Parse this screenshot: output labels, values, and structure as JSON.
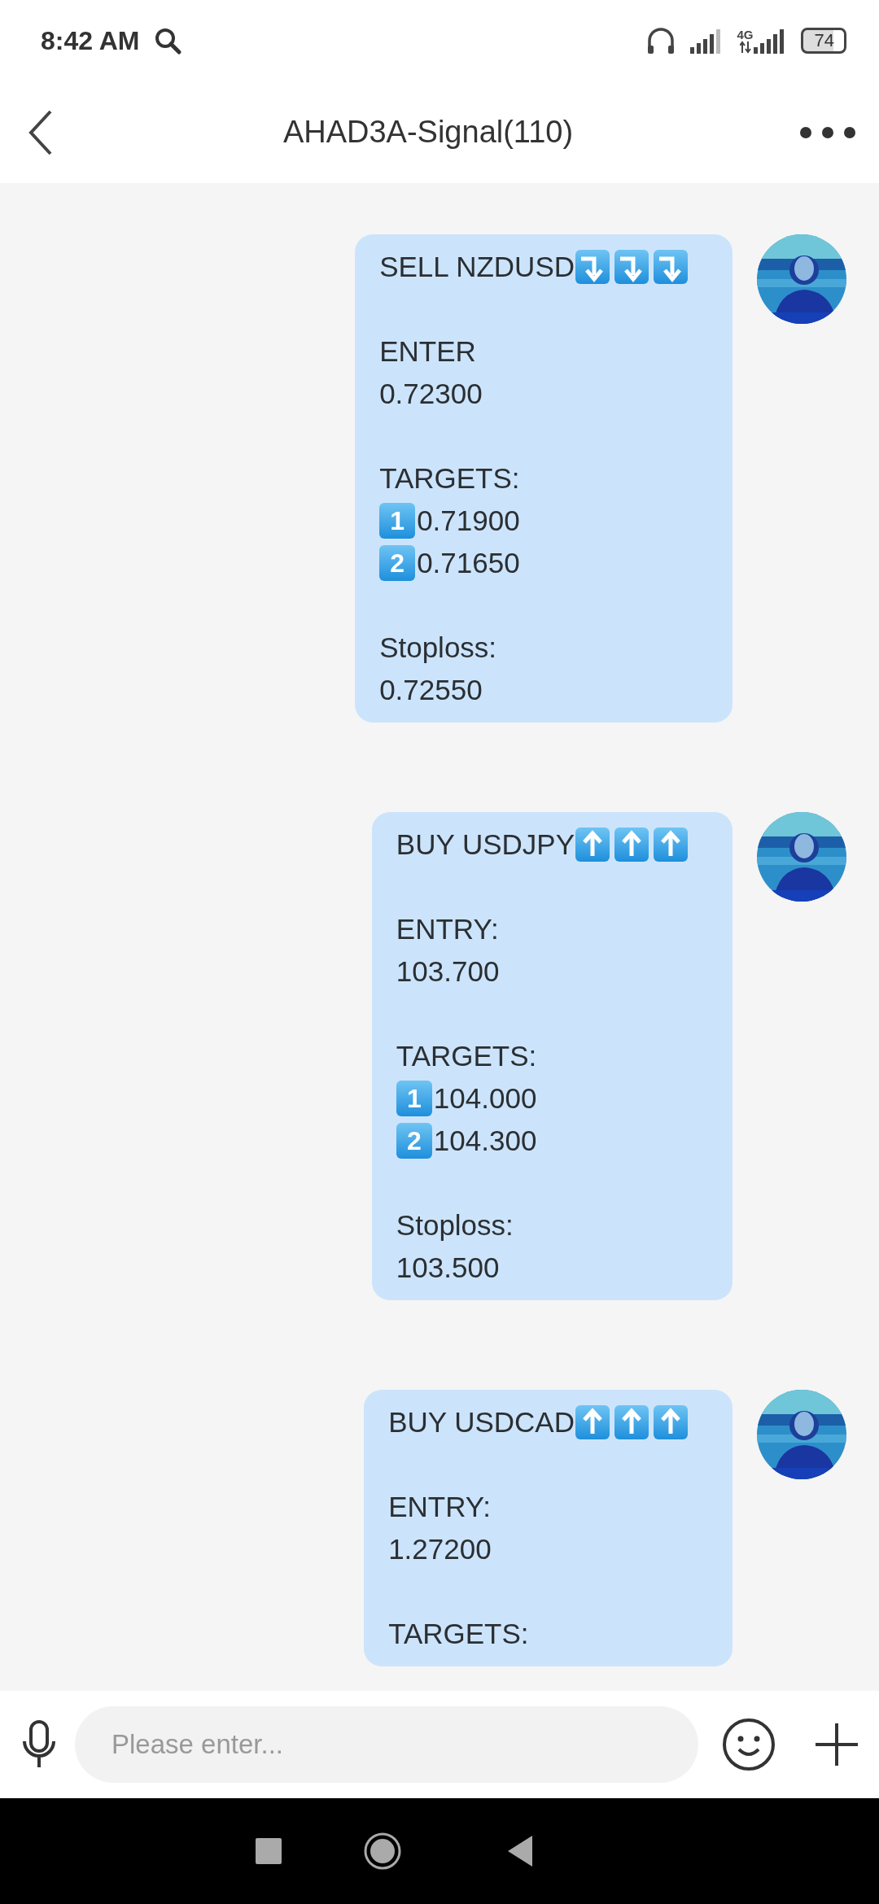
{
  "status_bar": {
    "time": "8:42 AM",
    "network": "4G",
    "battery": "74"
  },
  "header": {
    "title": "AHAD3A-Signal(110)"
  },
  "messages": [
    {
      "lines": [
        {
          "kind": "title",
          "text": "SELL NZDUSD",
          "arrows": [
            {
              "kind": "curve-down"
            },
            {
              "kind": "curve-down"
            },
            {
              "kind": "curve-down"
            }
          ]
        },
        {
          "kind": "blank"
        },
        {
          "kind": "text",
          "text": "ENTER"
        },
        {
          "kind": "text",
          "text": "0.72300"
        },
        {
          "kind": "blank"
        },
        {
          "kind": "text",
          "text": "TARGETS:"
        },
        {
          "kind": "target",
          "marker": "1",
          "text": "0.71900"
        },
        {
          "kind": "target",
          "marker": "2",
          "text": "0.71650"
        },
        {
          "kind": "blank"
        },
        {
          "kind": "text",
          "text": "Stoploss:"
        },
        {
          "kind": "text",
          "text": "0.72550"
        }
      ]
    },
    {
      "lines": [
        {
          "kind": "title",
          "text": "BUY USDJPY",
          "arrows": [
            {
              "kind": "up"
            },
            {
              "kind": "up"
            },
            {
              "kind": "up"
            }
          ]
        },
        {
          "kind": "blank"
        },
        {
          "kind": "text",
          "text": "ENTRY:"
        },
        {
          "kind": "text",
          "text": "103.700"
        },
        {
          "kind": "blank"
        },
        {
          "kind": "text",
          "text": "TARGETS:"
        },
        {
          "kind": "target",
          "marker": "1",
          "text": "104.000"
        },
        {
          "kind": "target",
          "marker": "2",
          "text": "104.300"
        },
        {
          "kind": "blank"
        },
        {
          "kind": "text",
          "text": "Stoploss:"
        },
        {
          "kind": "text",
          "text": "103.500"
        }
      ]
    },
    {
      "lines": [
        {
          "kind": "title",
          "text": "BUY USDCAD",
          "arrows": [
            {
              "kind": "up"
            },
            {
              "kind": "up"
            },
            {
              "kind": "up"
            }
          ]
        },
        {
          "kind": "blank"
        },
        {
          "kind": "text",
          "text": "ENTRY:"
        },
        {
          "kind": "text",
          "text": "1.27200"
        },
        {
          "kind": "blank"
        },
        {
          "kind": "text",
          "text": "TARGETS:"
        }
      ]
    }
  ],
  "composer": {
    "placeholder": "Please enter..."
  }
}
